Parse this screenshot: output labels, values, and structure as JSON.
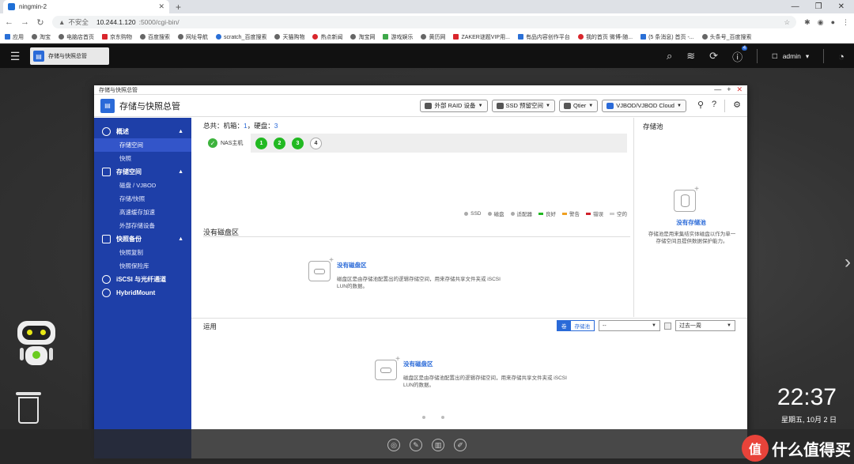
{
  "browser": {
    "tab_title": "ningmin-2",
    "insecure_label": "不安全",
    "url_host": "10.244.1.120",
    "url_path": ":5000/cgi-bin/",
    "bookmarks": [
      "应用",
      "淘宝",
      "电脑店首页",
      "京东购物",
      "百度搜索",
      "网址导航",
      "scratch_百度搜索",
      "天猫购物",
      "热点新闻",
      "淘宝网",
      "游戏娱乐",
      "黄历网",
      "ZAKER谜题VIP用...",
      "有品内容创作平台",
      "我的首页 微博-随...",
      "(5 条消息) 首页 -...",
      "头条号_百度搜索"
    ]
  },
  "qts": {
    "app_tab": "存储与快照总管",
    "user": "admin",
    "notification_count": "4"
  },
  "window": {
    "titlebar": "存储与快照总管",
    "title": "存储与快照总管",
    "toolbar": [
      "外部 RAID 设备",
      "SSD 预留空间",
      "Qtier",
      "VJBOD/VJBOD Cloud"
    ]
  },
  "sidebar": {
    "sections": [
      {
        "label": "概述",
        "items": [
          "存储空间",
          "快照"
        ]
      },
      {
        "label": "存储空间",
        "items": [
          "磁盘 / VJBOD",
          "存储/快照",
          "高速缓存加速",
          "外部存储设备"
        ]
      },
      {
        "label": "快照备份",
        "items": [
          "快照复制",
          "快照保险库"
        ]
      },
      {
        "label": "iSCSI 与光纤通道",
        "items": []
      },
      {
        "label": "HybridMount",
        "items": []
      }
    ],
    "active_item": "存储空间"
  },
  "overview": {
    "summary_prefix": "总共：机箱：",
    "enclosures": "1",
    "disks_label": "，硬盘：",
    "disks": "3",
    "nas_host": "NAS主机",
    "bays": [
      {
        "label": "1",
        "status": "good"
      },
      {
        "label": "2",
        "status": "good"
      },
      {
        "label": "3",
        "status": "good"
      },
      {
        "label": "4",
        "status": "empty"
      }
    ],
    "legend": [
      {
        "label": "SSD",
        "color": "#aaaaaa",
        "shape": "dot"
      },
      {
        "label": "磁盘",
        "color": "#aaaaaa",
        "shape": "dot"
      },
      {
        "label": "适配器",
        "color": "#aaaaaa",
        "shape": "dot"
      },
      {
        "label": "良好",
        "color": "#22b922",
        "shape": "bar"
      },
      {
        "label": "警告",
        "color": "#f0a020",
        "shape": "bar"
      },
      {
        "label": "错误",
        "color": "#d0202a",
        "shape": "bar"
      },
      {
        "label": "空的",
        "color": "#cccccc",
        "shape": "bar"
      }
    ],
    "no_volume_section": "没有磁盘区",
    "no_volume_heading": "没有磁盘区",
    "no_volume_desc": "磁盘区是由存储池配置出的逻辑存储空间，用来存储共享文件夹或 iSCSI LUN的数据。",
    "pool_title": "存储池",
    "no_pool_heading": "没有存储池",
    "no_pool_desc": "存储池是用来集结实体磁盘以作为单一存储空间且提供数据保护能力。"
  },
  "usage": {
    "title": "运用",
    "toggle": [
      "卷",
      "存储池"
    ],
    "volume_select": "--",
    "range_select": "过去一周",
    "empty_heading": "没有磁盘区",
    "empty_desc": "磁盘区是由存储池配置出的逻辑存储空间，用来存储共享文件夹或 iSCSI LUN的数据。"
  },
  "desktop": {
    "time": "22:37",
    "date": "星期五, 10月 2 日"
  },
  "watermark": {
    "badge": "值",
    "text": "什么值得买"
  }
}
